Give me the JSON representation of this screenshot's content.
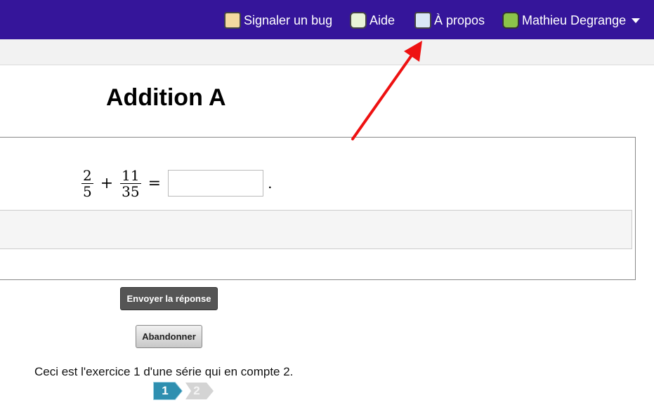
{
  "topbar": {
    "items": [
      {
        "label": "Signaler un bug",
        "icon": "bug-report-icon"
      },
      {
        "label": "Aide",
        "icon": "help-icon"
      },
      {
        "label": "À propos",
        "icon": "about-icon"
      },
      {
        "label": "Mathieu Degrange",
        "icon": "user-avatar-icon"
      }
    ],
    "background": "#35159a"
  },
  "main": {
    "title": "Addition A",
    "question": {
      "fraction1": {
        "numerator": "2",
        "denominator": "5"
      },
      "operator": "+",
      "fraction2": {
        "numerator": "11",
        "denominator": "35"
      },
      "equals": "=",
      "answer_value": "",
      "period": "."
    },
    "submit_label": "Envoyer la réponse",
    "abandon_label": "Abandonner",
    "series_text": "Ceci est l'exercice 1 d'une série qui en compte 2.",
    "steps": [
      {
        "label": "1",
        "current": true
      },
      {
        "label": "2",
        "current": false
      }
    ]
  },
  "annotation": {
    "arrow_color": "#ee1111"
  }
}
